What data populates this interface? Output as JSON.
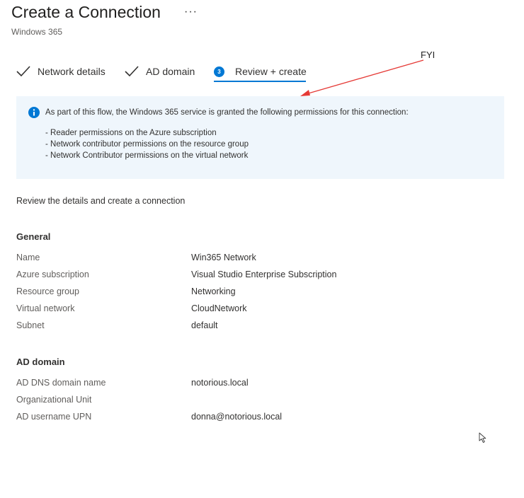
{
  "header": {
    "title": "Create a Connection",
    "more_label": "···",
    "subtitle": "Windows 365"
  },
  "steps": [
    {
      "label": "Network details",
      "state": "completed"
    },
    {
      "label": "AD domain",
      "state": "completed"
    },
    {
      "label": "Review + create",
      "number": "3",
      "state": "current"
    }
  ],
  "annotation": {
    "label": "FYI",
    "color": "#e53935"
  },
  "info": {
    "message": "As part of this flow, the Windows 365 service is granted the following permissions for this connection:",
    "items": [
      "- Reader permissions on the Azure subscription",
      "- Network contributor permissions on the resource group",
      "- Network Contributor permissions on the virtual network"
    ]
  },
  "review": {
    "intro": "Review the details and create a connection",
    "general": {
      "heading": "General",
      "rows": [
        {
          "label": "Name",
          "value": "Win365 Network"
        },
        {
          "label": "Azure subscription",
          "value": "Visual Studio Enterprise Subscription"
        },
        {
          "label": "Resource group",
          "value": "Networking"
        },
        {
          "label": "Virtual network",
          "value": "CloudNetwork"
        },
        {
          "label": "Subnet",
          "value": "default"
        }
      ]
    },
    "ad_domain": {
      "heading": "AD domain",
      "rows": [
        {
          "label": "AD DNS domain name",
          "value": "notorious.local"
        },
        {
          "label": "Organizational Unit",
          "value": ""
        },
        {
          "label": "AD username UPN",
          "value": "donna@notorious.local"
        }
      ]
    }
  },
  "colors": {
    "accent": "#0078d4",
    "info_bg": "#eff6fc"
  }
}
